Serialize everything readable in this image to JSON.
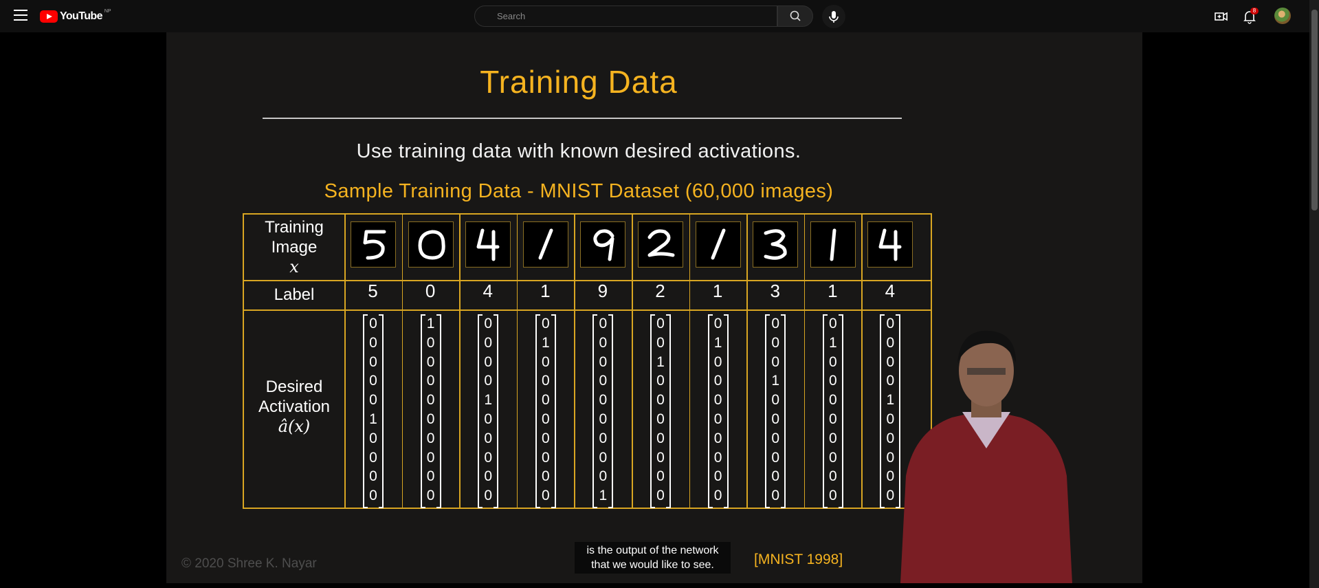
{
  "app": {
    "name": "YouTube",
    "country_code": "NP"
  },
  "search": {
    "placeholder": "Search"
  },
  "header": {
    "notification_count": "8"
  },
  "icons": {
    "menu": "hamburger-icon",
    "search": "search-icon",
    "mic": "mic-icon",
    "create": "create-video-icon",
    "notifications": "bell-icon",
    "avatar": "user-avatar"
  },
  "slide": {
    "title": "Training Data",
    "subtitle": "Use training data with known desired activations.",
    "dataset_heading": "Sample Training Data - MNIST Dataset (60,000 images)",
    "row_training_image": [
      "Training",
      "Image",
      "x"
    ],
    "row_label": "Label",
    "row_desired": [
      "Desired",
      "Activation",
      "â(x)"
    ],
    "labels": [
      "5",
      "0",
      "4",
      "1",
      "9",
      "2",
      "1",
      "3",
      "1",
      "4"
    ],
    "activations": [
      [
        "0",
        "0",
        "0",
        "0",
        "0",
        "1",
        "0",
        "0",
        "0",
        "0"
      ],
      [
        "1",
        "0",
        "0",
        "0",
        "0",
        "0",
        "0",
        "0",
        "0",
        "0"
      ],
      [
        "0",
        "0",
        "0",
        "0",
        "1",
        "0",
        "0",
        "0",
        "0",
        "0"
      ],
      [
        "0",
        "1",
        "0",
        "0",
        "0",
        "0",
        "0",
        "0",
        "0",
        "0"
      ],
      [
        "0",
        "0",
        "0",
        "0",
        "0",
        "0",
        "0",
        "0",
        "0",
        "1"
      ],
      [
        "0",
        "0",
        "1",
        "0",
        "0",
        "0",
        "0",
        "0",
        "0",
        "0"
      ],
      [
        "0",
        "1",
        "0",
        "0",
        "0",
        "0",
        "0",
        "0",
        "0",
        "0"
      ],
      [
        "0",
        "0",
        "0",
        "1",
        "0",
        "0",
        "0",
        "0",
        "0",
        "0"
      ],
      [
        "0",
        "1",
        "0",
        "0",
        "0",
        "0",
        "0",
        "0",
        "0",
        "0"
      ],
      [
        "0",
        "0",
        "0",
        "0",
        "1",
        "0",
        "0",
        "0",
        "0",
        "0"
      ]
    ],
    "copyright": "© 2020 Shree K. Nayar",
    "citation": "[MNIST 1998]"
  },
  "caption": {
    "line1": "is the output of the network",
    "line2": "that we would like to see."
  },
  "colors": {
    "accent": "#f5b320",
    "youtube_red": "#ff0000",
    "slide_bg": "#181716",
    "grid": "#d9a622"
  }
}
